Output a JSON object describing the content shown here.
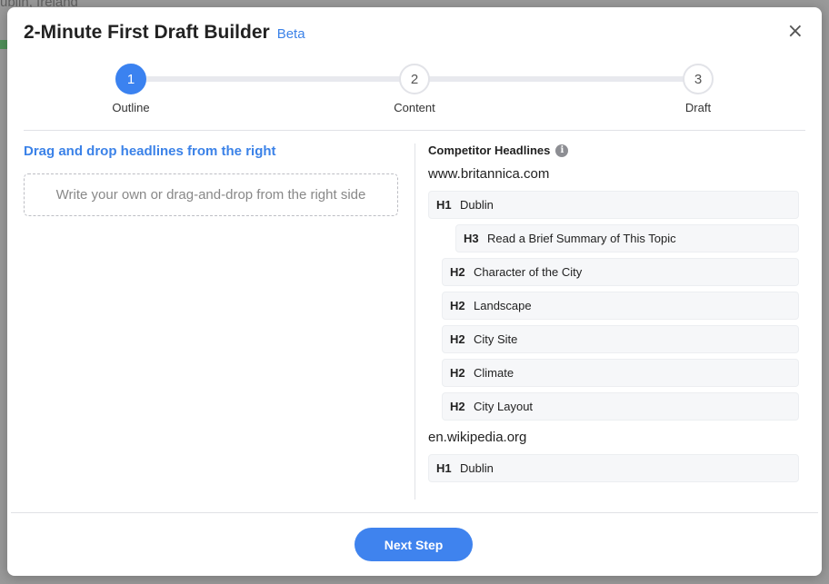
{
  "background": {
    "page_title_fragment": "ublin, Ireland"
  },
  "modal": {
    "title": "2-Minute First Draft Builder",
    "badge": "Beta",
    "close_label": "×"
  },
  "stepper": {
    "steps": [
      {
        "number": "1",
        "label": "Outline",
        "active": true
      },
      {
        "number": "2",
        "label": "Content",
        "active": false
      },
      {
        "number": "3",
        "label": "Draft",
        "active": false
      }
    ]
  },
  "left": {
    "heading": "Drag and drop headlines from the right",
    "drop_placeholder": "Write your own or drag-and-drop from the right side"
  },
  "right": {
    "heading": "Competitor Headlines",
    "info_icon": "i",
    "sources": [
      {
        "site": "www.britannica.com",
        "headlines": [
          {
            "tag": "H1",
            "text": "Dublin"
          },
          {
            "tag": "H3",
            "text": "Read a Brief Summary of This Topic"
          },
          {
            "tag": "H2",
            "text": "Character of the City"
          },
          {
            "tag": "H2",
            "text": "Landscape"
          },
          {
            "tag": "H2",
            "text": "City Site"
          },
          {
            "tag": "H2",
            "text": "Climate"
          },
          {
            "tag": "H2",
            "text": "City Layout"
          }
        ]
      },
      {
        "site": "en.wikipedia.org",
        "headlines": [
          {
            "tag": "H1",
            "text": "Dublin"
          }
        ]
      }
    ]
  },
  "footer": {
    "next_label": "Next Step"
  },
  "colors": {
    "accent": "#3b82f0",
    "beta": "#3b82e8"
  }
}
